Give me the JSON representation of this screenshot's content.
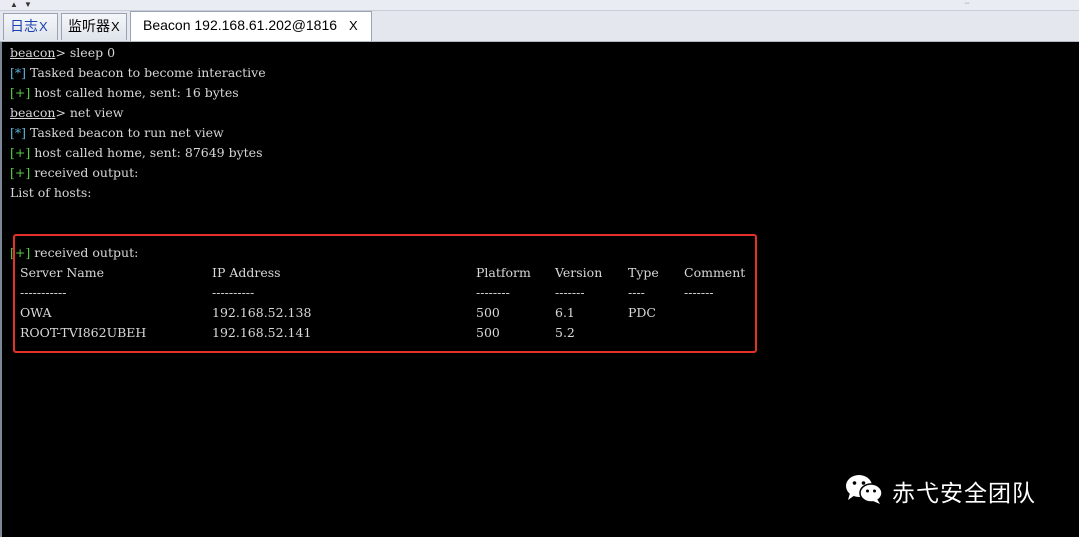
{
  "tabs": {
    "log": {
      "label": "日志",
      "close": "X"
    },
    "listener": {
      "label": "监听器",
      "close": "X"
    },
    "beacon": {
      "label": "Beacon 192.168.61.202@1816",
      "close": "X"
    }
  },
  "console": {
    "lines": [
      {
        "prompt": "beacon",
        "cmd": "> sleep 0"
      },
      {
        "tag": "[*]",
        "text": " Tasked beacon to become interactive"
      },
      {
        "tag": "[+]",
        "text": " host called home, sent: 16 bytes"
      },
      {
        "prompt": "beacon",
        "cmd": "> net view"
      },
      {
        "tag": "[*]",
        "text": " Tasked beacon to run net view"
      },
      {
        "tag": "[+]",
        "text": " host called home, sent: 87649 bytes"
      },
      {
        "tag": "[+]",
        "text": " received output:"
      },
      {
        "text": "List of hosts:"
      },
      {
        "tag": "[+]",
        "text": " received output:"
      }
    ],
    "table": {
      "headers": [
        "Server Name",
        "IP Address",
        "Platform",
        "Version",
        "Type",
        "Comment"
      ],
      "dividers": [
        "-----------",
        "----------",
        "--------",
        "-------",
        "----",
        "-------"
      ],
      "rows": [
        [
          "OWA",
          "192.168.52.138",
          "500",
          "6.1",
          "PDC",
          ""
        ],
        [
          "ROOT-TVI862UBEH",
          "192.168.52.141",
          "500",
          "5.2",
          "",
          ""
        ]
      ]
    }
  },
  "watermark": {
    "text": "赤弋安全团队",
    "icon": "wechat-icon"
  }
}
